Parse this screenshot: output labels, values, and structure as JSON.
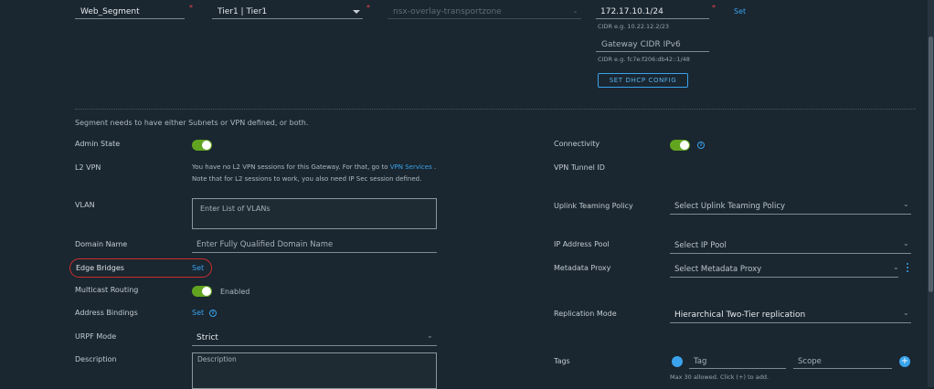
{
  "top_row": {
    "segment_name": "Web_Segment",
    "gateway": "Tier1 | Tier1",
    "transport_zone": "nsx-overlay-transportzone",
    "gateway_cidr_ipv4": "172.17.10.1/24",
    "gateway_cidr_ipv4_hint": "CIDR e.g. 10.22.12.2/23",
    "set_link": "Set",
    "gateway_cidr_ipv6_placeholder": "Gateway CIDR IPv6",
    "gateway_cidr_ipv6_hint": "CIDR e.g. fc7e:f206:db42::1/48",
    "dhcp_button": "SET DHCP CONFIG"
  },
  "notice": "Segment needs to have either Subnets or VPN defined, or both.",
  "left": {
    "admin_state_label": "Admin State",
    "l2vpn_label": "L2 VPN",
    "l2vpn_text_1": "You have no L2 VPN sessions for this Gateway. For that, go to",
    "l2vpn_link": "VPN Services",
    "l2vpn_text_2": ". Note that for L2 sessions to work, you also need IP Sec session defined.",
    "vlan_label": "VLAN",
    "vlan_placeholder": "Enter List of VLANs",
    "domain_label": "Domain Name",
    "domain_placeholder": "Enter Fully Qualified Domain Name",
    "edge_bridges_label": "Edge Bridges",
    "edge_bridges_link": "Set",
    "multicast_label": "Multicast Routing",
    "multicast_state": "Enabled",
    "address_bindings_label": "Address Bindings",
    "address_bindings_link": "Set",
    "urpf_label": "URPF Mode",
    "urpf_value": "Strict",
    "description_label": "Description",
    "description_placeholder": "Description"
  },
  "right": {
    "connectivity_label": "Connectivity",
    "vpn_tunnel_label": "VPN Tunnel ID",
    "uplink_label": "Uplink Teaming Policy",
    "uplink_placeholder": "Select Uplink Teaming Policy",
    "ip_pool_label": "IP Address Pool",
    "ip_pool_placeholder": "Select IP Pool",
    "metadata_label": "Metadata Proxy",
    "metadata_placeholder": "Select Metadata Proxy",
    "replication_label": "Replication Mode",
    "replication_value": "Hierarchical Two-Tier replication",
    "tags_label": "Tags",
    "tag_placeholder": "Tag",
    "scope_placeholder": "Scope",
    "tags_hint": "Max 30 allowed. Click (+) to add."
  },
  "colors": {
    "background": "#1a2630",
    "accent": "#3aa3ec",
    "toggle_on": "#62a420",
    "required": "#e8474b",
    "highlight": "#c8302c"
  }
}
